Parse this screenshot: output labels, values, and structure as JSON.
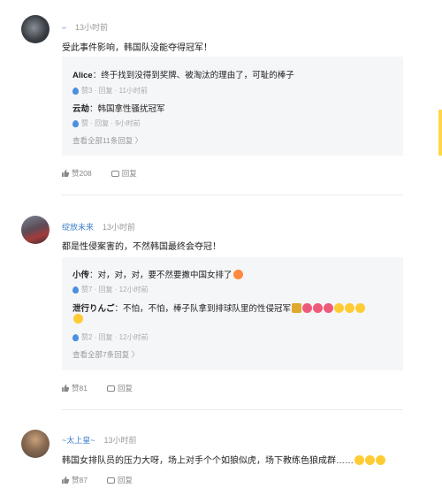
{
  "comments": [
    {
      "username": "–",
      "time": "13小时前",
      "text": "受此事件影响，韩国队没能夺得冠军！",
      "replies": [
        {
          "name": "Alice",
          "text": "：终于找到没得到奖牌、被淘汰的理由了，可耻的棒子",
          "meta": "赞3 · 回复 · 11小时前"
        },
        {
          "name": "云劫",
          "text": "：韩国拿性骚扰冠军",
          "meta": "赞 · 回复 · 9小时前"
        }
      ],
      "view_all": "查看全部11条回复 〉",
      "like_label": "赞208",
      "reply_label": "回复"
    },
    {
      "username": "绽放未来",
      "time": "13小时前",
      "text": "都是性侵案害的，不然韩国最终会夺冠！",
      "replies": [
        {
          "name": "小传",
          "text": "：对，对，对，要不然要撒中国女排了",
          "meta": "赞7 · 回复 · 12小时前"
        },
        {
          "name": "泄行りんご",
          "text": "：不怕，不怕，棒子队拿到排球队里的性侵冠军",
          "meta": "赞2 · 回复 · 12小时前"
        }
      ],
      "view_all": "查看全部7条回复 〉",
      "like_label": "赞81",
      "reply_label": "回复"
    },
    {
      "username": "~太上皇~",
      "time": "13小时前",
      "text": "韩国女排队员的压力大呀，场上对手个个如狼似虎，场下教练色狼成群……",
      "like_label": "赞87",
      "reply_label": "回复"
    }
  ]
}
